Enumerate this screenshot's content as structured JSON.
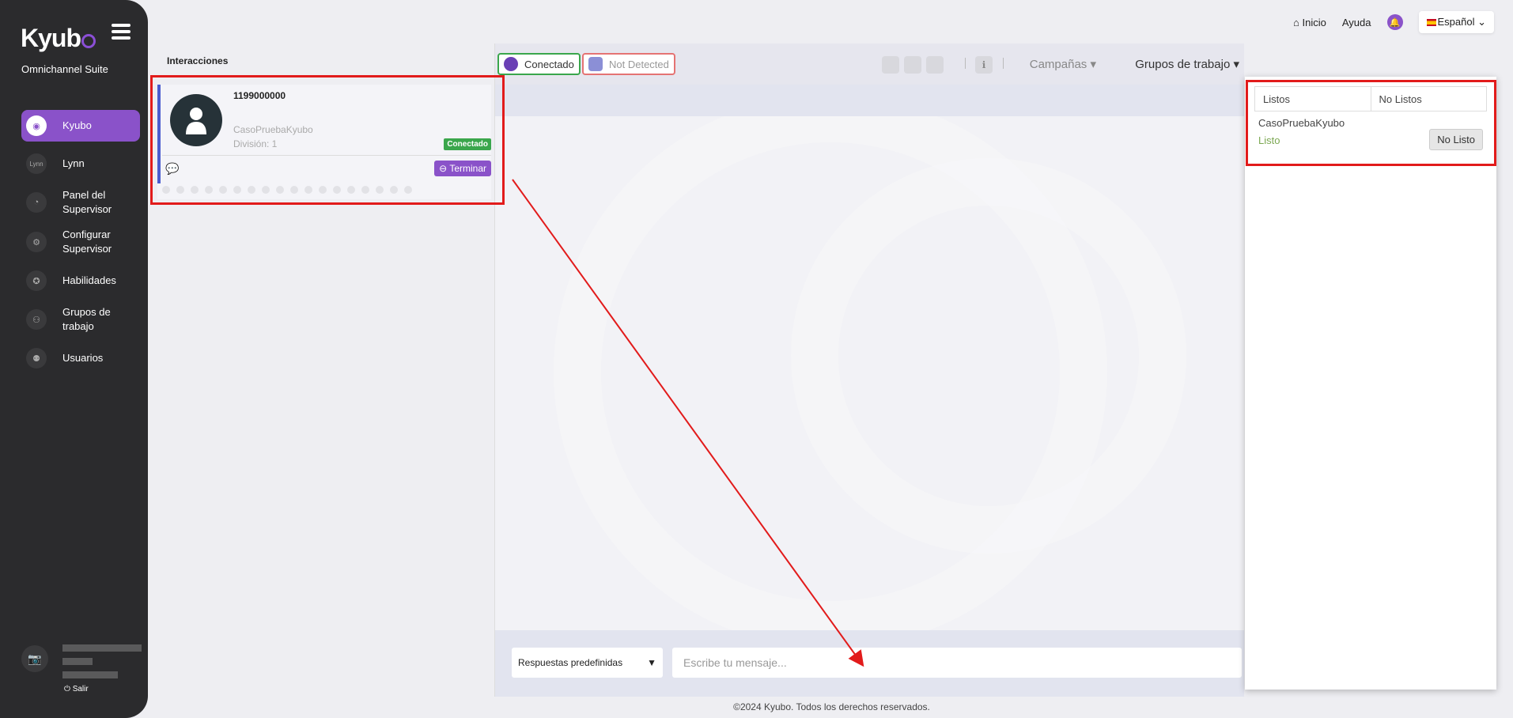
{
  "brand": {
    "logo": "Kyub",
    "suite": "Omnichannel Suite"
  },
  "sidebar": {
    "items": [
      {
        "label": "Kyubo",
        "active": true
      },
      {
        "label": "Lynn",
        "icon_text": "Lynn"
      },
      {
        "label": "Panel del Supervisor"
      },
      {
        "label": "Configurar Supervisor"
      },
      {
        "label": "Habilidades"
      },
      {
        "label": "Grupos de trabajo"
      },
      {
        "label": "Usuarios"
      }
    ],
    "logout": "Salir"
  },
  "header": {
    "home": "Inicio",
    "help": "Ayuda",
    "language": "Español"
  },
  "interactions": {
    "title": "Interacciones",
    "card": {
      "phone": "1199000000",
      "campaign": "CasoPruebaKyubo",
      "division": "División: 1",
      "status": "Conectado",
      "end_button": "Terminar"
    }
  },
  "chat": {
    "connected_pill": "Conectado",
    "not_detected_pill": "Not Detected",
    "campaigns": "Campañas",
    "workgroups": "Grupos de trabajo",
    "predefined": "Respuestas predefinidas",
    "message_placeholder": "Escribe tu mensaje..."
  },
  "workgroup_panel": {
    "tabs": [
      "Listos",
      "No Listos"
    ],
    "group_name": "CasoPruebaKyubo",
    "group_status": "Listo",
    "toggle_button": "No Listo"
  },
  "footer": "©2024 Kyubo. Todos los derechos reservados.",
  "colors": {
    "accent": "#8a52c9",
    "success": "#3aa64c",
    "annotation": "#e21b1b"
  }
}
